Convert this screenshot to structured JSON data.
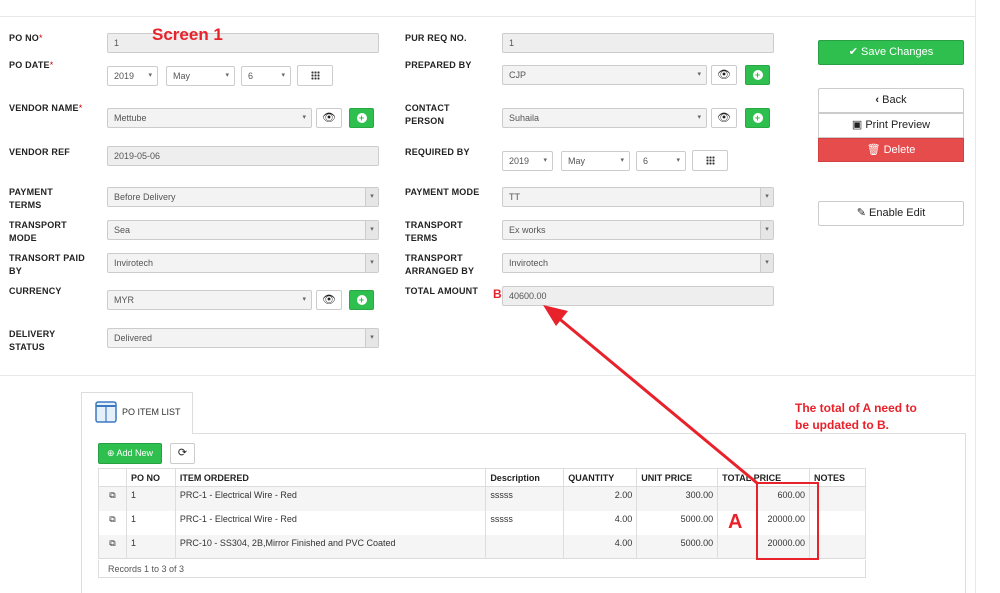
{
  "annotations": {
    "screen_label": "Screen 1",
    "marker_a": "A",
    "marker_b": "B",
    "note_line1": "The total of A need to",
    "note_line2": "be updated to B.",
    "accent_color": "#e8222b"
  },
  "form": {
    "po_no": {
      "label": "PO NO",
      "required": "*",
      "value": "1"
    },
    "po_date": {
      "label": "PO DATE",
      "required": "*",
      "year": "2019",
      "month": "May",
      "day": "6"
    },
    "vendor_name": {
      "label": "VENDOR NAME",
      "required": "*",
      "value": "Mettube"
    },
    "vendor_ref": {
      "label": "VENDOR REF",
      "value": "2019-05-06"
    },
    "payment_terms": {
      "label_line1": "PAYMENT",
      "label_line2": "TERMS",
      "value": "Before Delivery"
    },
    "transport_mode": {
      "label_line1": "TRANSPORT",
      "label_line2": "MODE",
      "value": "Sea"
    },
    "transport_paid_by": {
      "label_line1": "TRANSORT PAID",
      "label_line2": "BY",
      "value": "Invirotech"
    },
    "currency": {
      "label": "CURRENCY",
      "value": "MYR"
    },
    "delivery_status": {
      "label_line1": "DELIVERY",
      "label_line2": "STATUS",
      "value": "Delivered"
    },
    "pur_req_no": {
      "label": "PUR REQ NO.",
      "value": "1"
    },
    "prepared_by": {
      "label": "PREPARED BY",
      "value": "CJP"
    },
    "contact_person": {
      "label_line1": "CONTACT",
      "label_line2": "PERSON",
      "value": "Suhaila"
    },
    "required_by": {
      "label": "REQUIRED BY",
      "year": "2019",
      "month": "May",
      "day": "6"
    },
    "payment_mode": {
      "label": "PAYMENT MODE",
      "value": "TT"
    },
    "transport_terms": {
      "label_line1": "TRANSPORT",
      "label_line2": "TERMS",
      "value": "Ex works"
    },
    "transport_arranged_by": {
      "label_line1": "TRANSPORT",
      "label_line2": "ARRANGED BY",
      "value": "Invirotech"
    },
    "total_amount": {
      "label": "TOTAL AMOUNT",
      "value": "40600.00"
    }
  },
  "actions": {
    "save_label": "Save Changes",
    "back_label": "Back",
    "print_label": "Print Preview",
    "delete_label": "Delete",
    "enable_edit_label": "Enable Edit",
    "save_color": "#2fbf4f",
    "delete_color": "#e74c4c"
  },
  "items_tab": {
    "label": "PO ITEM LIST",
    "add_new_label": "Add New",
    "columns": [
      "PO NO",
      "ITEM ORDERED",
      "Description",
      "QUANTITY",
      "UNIT PRICE",
      "TOTAL PRICE",
      "NOTES"
    ],
    "rows": [
      {
        "po_no": "1",
        "item": "PRC-1 - Electrical Wire - Red",
        "description": "sssss",
        "quantity": "2.00",
        "unit_price": "300.00",
        "total_price": "600.00",
        "notes": ""
      },
      {
        "po_no": "1",
        "item": "PRC-1 - Electrical Wire - Red",
        "description": "sssss",
        "quantity": "4.00",
        "unit_price": "5000.00",
        "total_price": "20000.00",
        "notes": ""
      },
      {
        "po_no": "1",
        "item": "PRC-10 - SS304, 2B,Mirror Finished and PVC Coated",
        "description": "",
        "quantity": "4.00",
        "unit_price": "5000.00",
        "total_price": "20000.00",
        "notes": ""
      }
    ],
    "records_text": "Records 1 to 3 of 3"
  }
}
